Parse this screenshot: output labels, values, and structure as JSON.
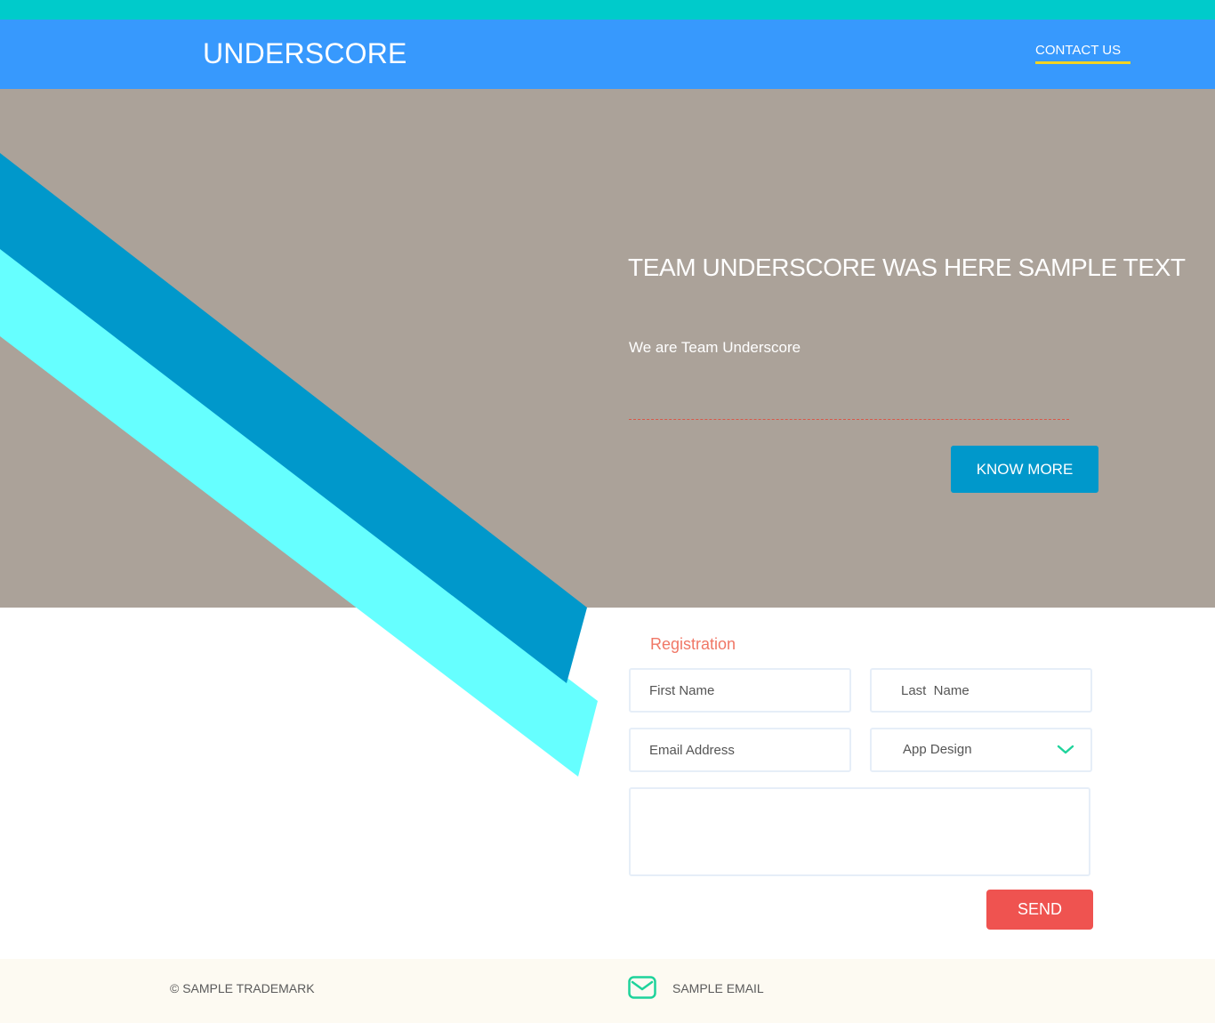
{
  "header": {
    "brand": "UNDERSCORE",
    "nav_link": "CONTACT US"
  },
  "hero": {
    "title": "TEAM UNDERSCORE WAS HERE SAMPLE TEXT",
    "subtitle": "We are Team Underscore",
    "button_label": "KNOW MORE"
  },
  "form": {
    "title": "Registration",
    "first_name_placeholder": "First Name",
    "last_name_placeholder": "Last  Name",
    "email_placeholder": "Email Address",
    "category_value": "App Design",
    "message_value": "",
    "send_label": "SEND"
  },
  "footer": {
    "trademark": "© SAMPLE TRADEMARK",
    "email": "SAMPLE EMAIL"
  },
  "colors": {
    "top_strip": "#00cbcb",
    "header": "#3799fd",
    "hero_bg": "#aba299",
    "stripe_dark": "#0098cb",
    "stripe_light": "#66ffff",
    "nav_underline": "#f3d321",
    "accent_red": "#ef5350",
    "registration_title": "#f07766",
    "icon_green": "#1ed39b",
    "footer_bg": "#fdfaf2"
  },
  "icons": {
    "dropdown": "chevron-down-icon",
    "footer_email": "envelope-icon"
  }
}
